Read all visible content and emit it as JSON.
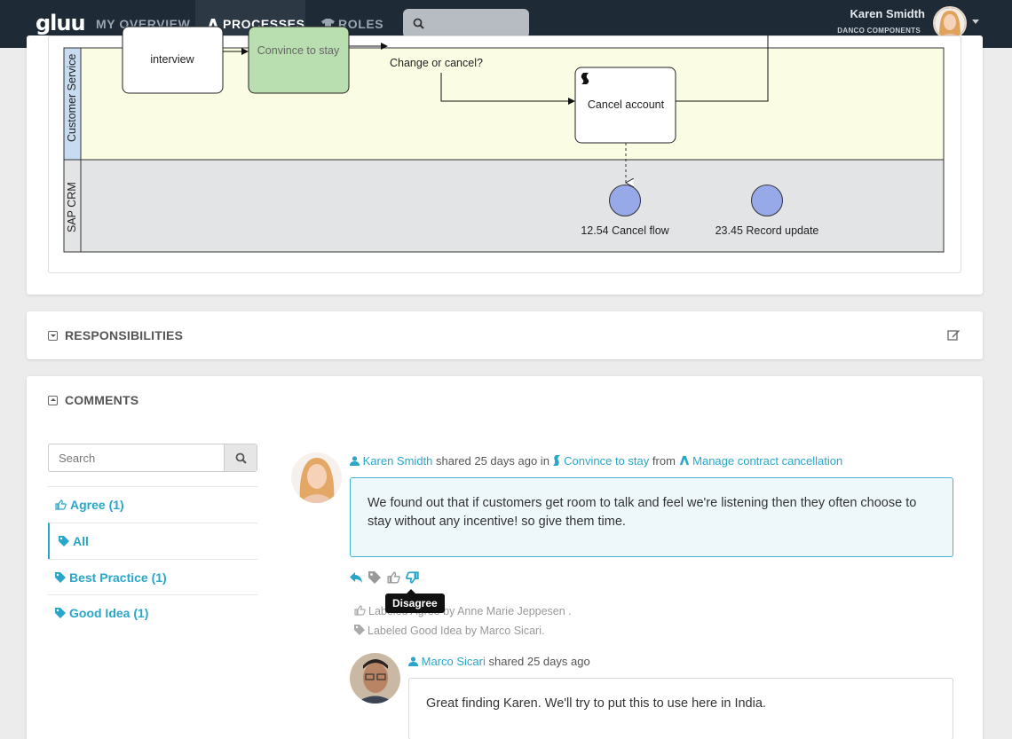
{
  "app": {
    "logo": "gluu",
    "nav": [
      {
        "label": "MY OVERVIEW"
      },
      {
        "label": "PROCESSES"
      },
      {
        "label": "ROLES"
      }
    ],
    "active_nav": "PROCESSES",
    "search_placeholder": ""
  },
  "user": {
    "name": "Karen Smidth",
    "company": "DANCO COMPONENTS"
  },
  "diagram": {
    "lanes": [
      "Customer Service",
      "SAP CRM"
    ],
    "tasks": [
      {
        "label": "interview"
      },
      {
        "label": "Convince to stay",
        "highlight_color": "#b9dfb1"
      },
      {
        "label": "Cancel account"
      }
    ],
    "gateway_label": "Change or cancel?",
    "events": [
      {
        "label": "12.54 Cancel flow"
      },
      {
        "label": "23.45 Record update"
      }
    ],
    "lane_colors": {
      "customer_service": "#fbfce4",
      "sap_crm": "#e3e4e6"
    }
  },
  "sections": {
    "responsibilities": "RESPONSIBILITIES",
    "comments": "COMMENTS"
  },
  "comments_panel": {
    "search_placeholder": "Search",
    "filters": [
      {
        "label": "Agree (1)",
        "icon": "thumbs-up-icon"
      },
      {
        "label": "All",
        "icon": "tag-icon",
        "selected": true
      },
      {
        "label": "Best Practice (1)",
        "icon": "tag-icon"
      },
      {
        "label": "Good Idea (1)",
        "icon": "tag-icon"
      }
    ],
    "comment1": {
      "author": "Karen Smidth",
      "shared_text": " shared 25 days ago in ",
      "activity": "Convince to stay",
      "from_text": " from ",
      "process": "Manage contract cancellation",
      "body": "We found out that if customers get room to talk and feel we're listening then they often choose to stay without any incentive! so give them time."
    },
    "actions": [
      "reply-icon",
      "tag-icon",
      "thumbs-up-icon",
      "thumbs-down-icon"
    ],
    "tooltip": "Disagree",
    "activity_log": [
      {
        "prefix": "Labeled ",
        "label": "Agree",
        "by": " by Anne Marie Jeppesen ."
      },
      {
        "prefix": "Labeled ",
        "label": "Good Idea",
        "by": " by Marco Sicari."
      }
    ],
    "comment2": {
      "author": "Marco Sicari",
      "shared_text": " shared 25 days ago",
      "body": "Great finding Karen. We'll try to put this to use here in India."
    },
    "accent_color": "#29a6c9"
  }
}
